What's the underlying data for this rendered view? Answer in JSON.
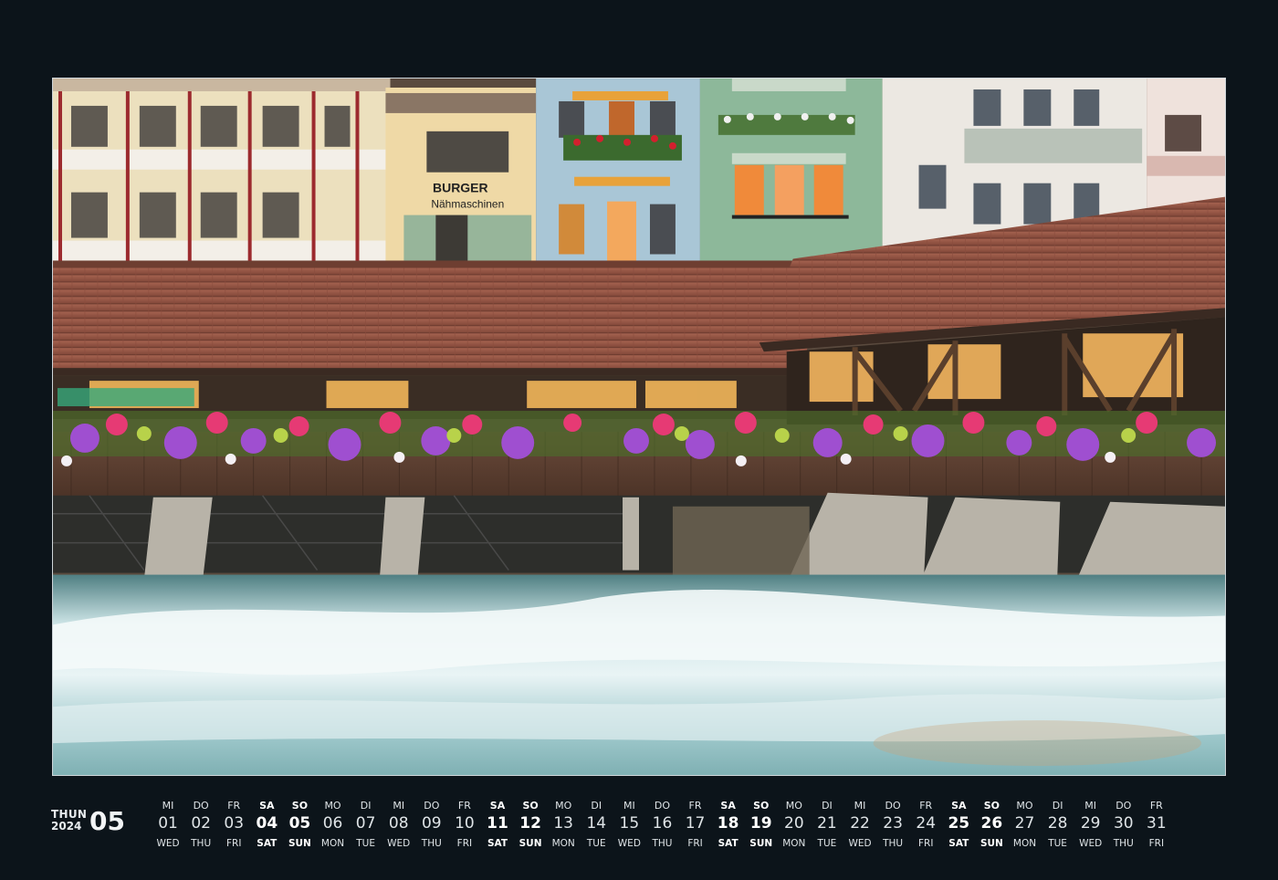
{
  "calendar": {
    "place": "THUN",
    "year": "2024",
    "month": "05"
  },
  "days": [
    {
      "de": "MI",
      "num": "01",
      "en": "WED",
      "weekend": false
    },
    {
      "de": "DO",
      "num": "02",
      "en": "THU",
      "weekend": false
    },
    {
      "de": "FR",
      "num": "03",
      "en": "FRI",
      "weekend": false
    },
    {
      "de": "SA",
      "num": "04",
      "en": "SAT",
      "weekend": true
    },
    {
      "de": "SO",
      "num": "05",
      "en": "SUN",
      "weekend": true
    },
    {
      "de": "MO",
      "num": "06",
      "en": "MON",
      "weekend": false
    },
    {
      "de": "DI",
      "num": "07",
      "en": "TUE",
      "weekend": false
    },
    {
      "de": "MI",
      "num": "08",
      "en": "WED",
      "weekend": false
    },
    {
      "de": "DO",
      "num": "09",
      "en": "THU",
      "weekend": false
    },
    {
      "de": "FR",
      "num": "10",
      "en": "FRI",
      "weekend": false
    },
    {
      "de": "SA",
      "num": "11",
      "en": "SAT",
      "weekend": true
    },
    {
      "de": "SO",
      "num": "12",
      "en": "SUN",
      "weekend": true
    },
    {
      "de": "MO",
      "num": "13",
      "en": "MON",
      "weekend": false
    },
    {
      "de": "DI",
      "num": "14",
      "en": "TUE",
      "weekend": false
    },
    {
      "de": "MI",
      "num": "15",
      "en": "WED",
      "weekend": false
    },
    {
      "de": "DO",
      "num": "16",
      "en": "THU",
      "weekend": false
    },
    {
      "de": "FR",
      "num": "17",
      "en": "FRI",
      "weekend": false
    },
    {
      "de": "SA",
      "num": "18",
      "en": "SAT",
      "weekend": true
    },
    {
      "de": "SO",
      "num": "19",
      "en": "SUN",
      "weekend": true
    },
    {
      "de": "MO",
      "num": "20",
      "en": "MON",
      "weekend": false
    },
    {
      "de": "DI",
      "num": "21",
      "en": "TUE",
      "weekend": false
    },
    {
      "de": "MI",
      "num": "22",
      "en": "WED",
      "weekend": false
    },
    {
      "de": "DO",
      "num": "23",
      "en": "THU",
      "weekend": false
    },
    {
      "de": "FR",
      "num": "24",
      "en": "FRI",
      "weekend": false
    },
    {
      "de": "SA",
      "num": "25",
      "en": "SAT",
      "weekend": true
    },
    {
      "de": "SO",
      "num": "26",
      "en": "SUN",
      "weekend": true
    },
    {
      "de": "MO",
      "num": "27",
      "en": "MON",
      "weekend": false
    },
    {
      "de": "DI",
      "num": "28",
      "en": "TUE",
      "weekend": false
    },
    {
      "de": "MI",
      "num": "29",
      "en": "WED",
      "weekend": false
    },
    {
      "de": "DO",
      "num": "30",
      "en": "THU",
      "weekend": false
    },
    {
      "de": "FR",
      "num": "31",
      "en": "FRI",
      "weekend": false
    }
  ],
  "photo": {
    "sign_line1": "BURGER",
    "sign_line2": "Nähmaschinen"
  },
  "colors": {
    "background": "#0c141a",
    "roof": "#9a5a48",
    "water": "#a9cdd0"
  }
}
